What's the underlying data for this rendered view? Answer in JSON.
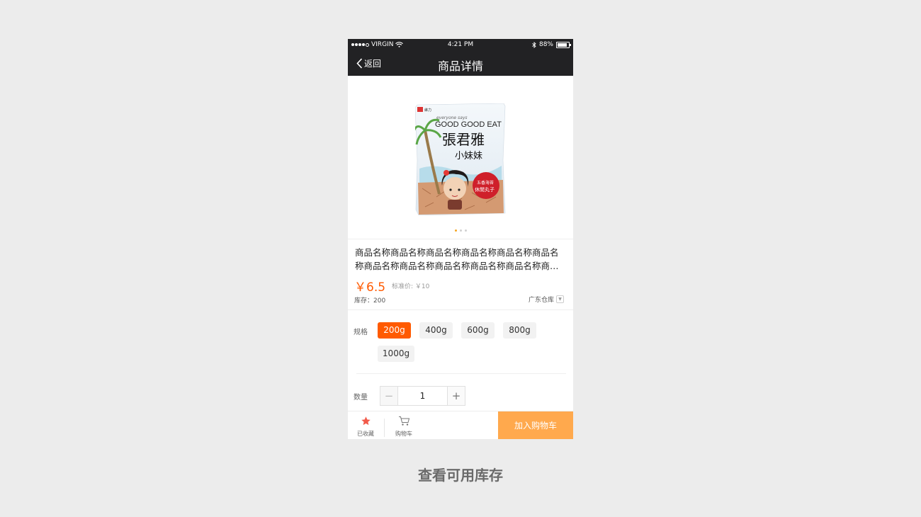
{
  "status_bar": {
    "carrier": "VIRGIN",
    "time": "4:21 PM",
    "battery": "88%",
    "battery_level": 0.88
  },
  "nav": {
    "back_label": "返回",
    "title": "商品详情"
  },
  "gallery": {
    "image_count": 3,
    "active_index": 0,
    "packaging_text": [
      "everyone says",
      "GOOD GOOD EAT",
      "張君雅",
      "小妹妹",
      "五香海苔",
      "休閒丸子"
    ]
  },
  "product": {
    "name": "商品名称商品名称商品名称商品名称商品名称商品名称商品名称商品名称商品名称商品名称商品名称商品名称",
    "price": "￥6.5",
    "standard_price": "标准价: ￥10",
    "stock": "库存：200",
    "warehouse": "广东仓库"
  },
  "spec": {
    "label": "规格",
    "options": [
      "200g",
      "400g",
      "600g",
      "800g",
      "1000g"
    ],
    "selected": "200g"
  },
  "quantity": {
    "label": "数量",
    "value": "1",
    "minus": "−",
    "plus": "+"
  },
  "bottom_bar": {
    "favorite_label": "已收藏",
    "cart_label": "购物车",
    "add_to_cart": "加入购物车",
    "favorite_color": "#f25a4a",
    "button_color": "#ffa94d"
  },
  "caption": "查看可用库存",
  "colors": {
    "accent": "#ff5a00",
    "header_bg": "#222224"
  }
}
